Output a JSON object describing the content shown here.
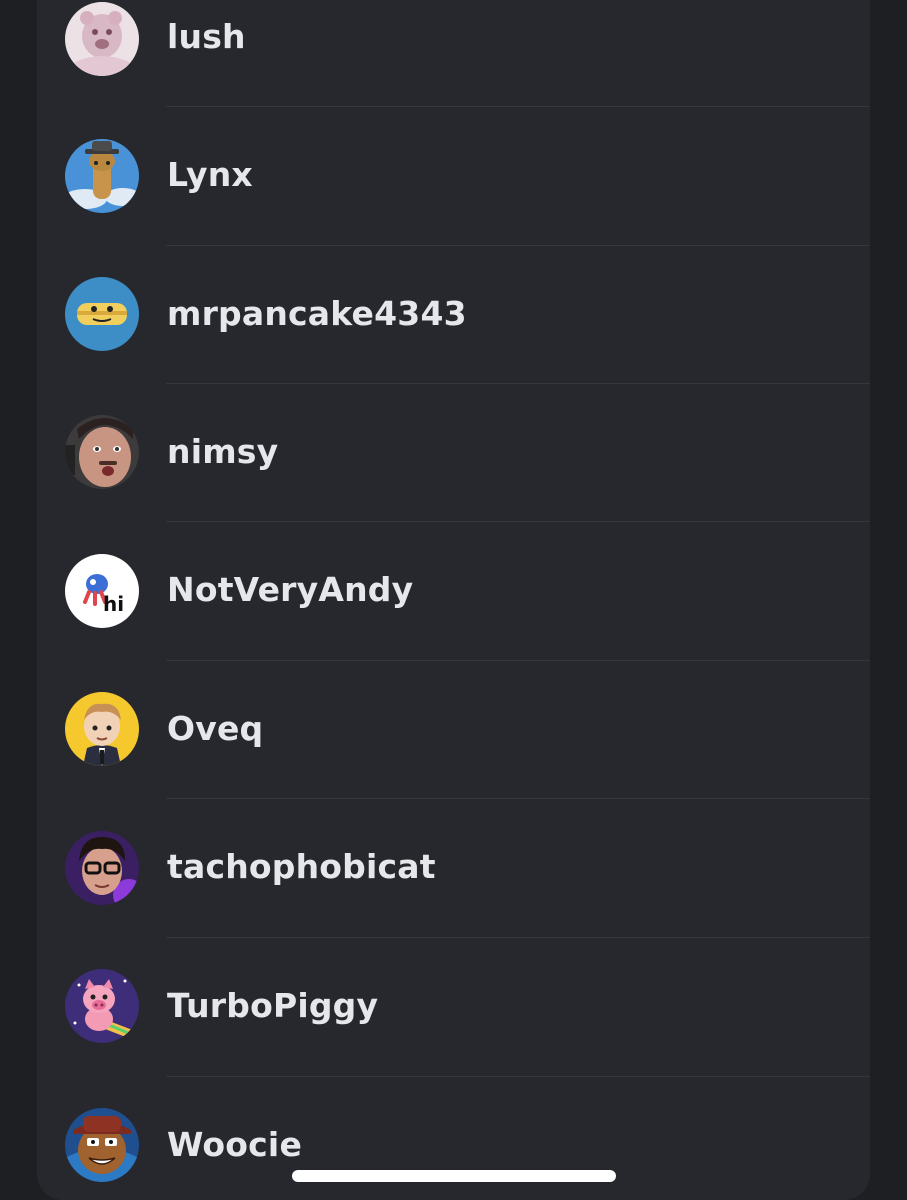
{
  "members": [
    {
      "name": "lush",
      "avatar": "lush-avatar"
    },
    {
      "name": "Lynx",
      "avatar": "lynx-avatar"
    },
    {
      "name": "mrpancake4343",
      "avatar": "mrpancake-avatar"
    },
    {
      "name": "nimsy",
      "avatar": "nimsy-avatar"
    },
    {
      "name": "NotVeryAndy",
      "avatar": "notveryandy-avatar"
    },
    {
      "name": "Oveq",
      "avatar": "oveq-avatar"
    },
    {
      "name": "tachophobicat",
      "avatar": "tachophobicat-avatar"
    },
    {
      "name": "TurboPiggy",
      "avatar": "turbopiggy-avatar"
    },
    {
      "name": "Woocie",
      "avatar": "woocie-avatar"
    }
  ],
  "avatar_text": {
    "notveryandy": "hi"
  },
  "colors": {
    "background": "#1e1f22",
    "sheet": "#27282e",
    "text": "#e6e7ea",
    "divider": "#35373d"
  }
}
